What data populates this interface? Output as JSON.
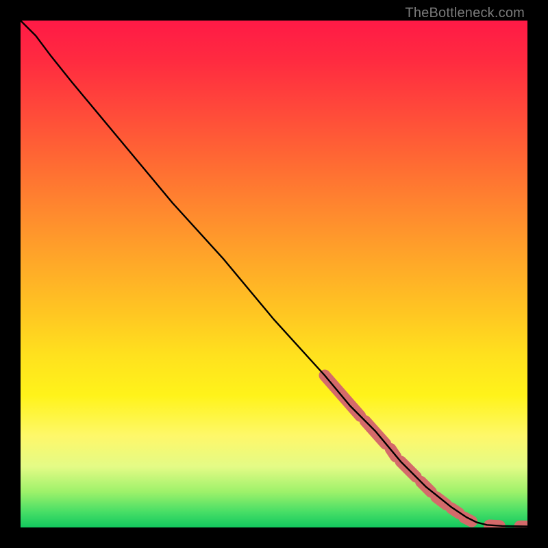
{
  "watermark": {
    "text": "TheBottleneck.com"
  },
  "chart_data": {
    "type": "line",
    "title": "",
    "xlabel": "",
    "ylabel": "",
    "xlim": [
      0,
      100
    ],
    "ylim": [
      0,
      100
    ],
    "grid": false,
    "series": [
      {
        "name": "curve",
        "color": "#000000",
        "x": [
          0,
          3,
          6,
          10,
          15,
          20,
          30,
          40,
          50,
          60,
          65,
          70,
          75,
          80,
          85,
          88,
          90,
          92,
          95,
          100
        ],
        "y": [
          100,
          97,
          93,
          88,
          82,
          76,
          64,
          53,
          41,
          30,
          24,
          19,
          13,
          8,
          4,
          2,
          1,
          0.5,
          0.3,
          0.2
        ]
      }
    ],
    "markers": {
      "name": "highlight",
      "shape": "rounded-bar",
      "color": "#d46a6a",
      "segments": [
        {
          "x0": 60,
          "y0": 30,
          "x1": 67,
          "y1": 22
        },
        {
          "x0": 68,
          "y0": 21,
          "x1": 72,
          "y1": 16.5
        },
        {
          "x0": 73,
          "y0": 15.5,
          "x1": 74,
          "y1": 14
        },
        {
          "x0": 75,
          "y0": 13,
          "x1": 78,
          "y1": 10
        },
        {
          "x0": 79,
          "y0": 9,
          "x1": 81,
          "y1": 7
        },
        {
          "x0": 82,
          "y0": 6,
          "x1": 84,
          "y1": 4.5
        },
        {
          "x0": 85,
          "y0": 3.8,
          "x1": 86.5,
          "y1": 2.8
        },
        {
          "x0": 87.5,
          "y0": 2.0,
          "x1": 89,
          "y1": 1.2
        },
        {
          "x0": 92.5,
          "y0": 0.4,
          "x1": 94.5,
          "y1": 0.3
        },
        {
          "x0": 98.5,
          "y0": 0.22,
          "x1": 100,
          "y1": 0.2
        }
      ]
    }
  }
}
